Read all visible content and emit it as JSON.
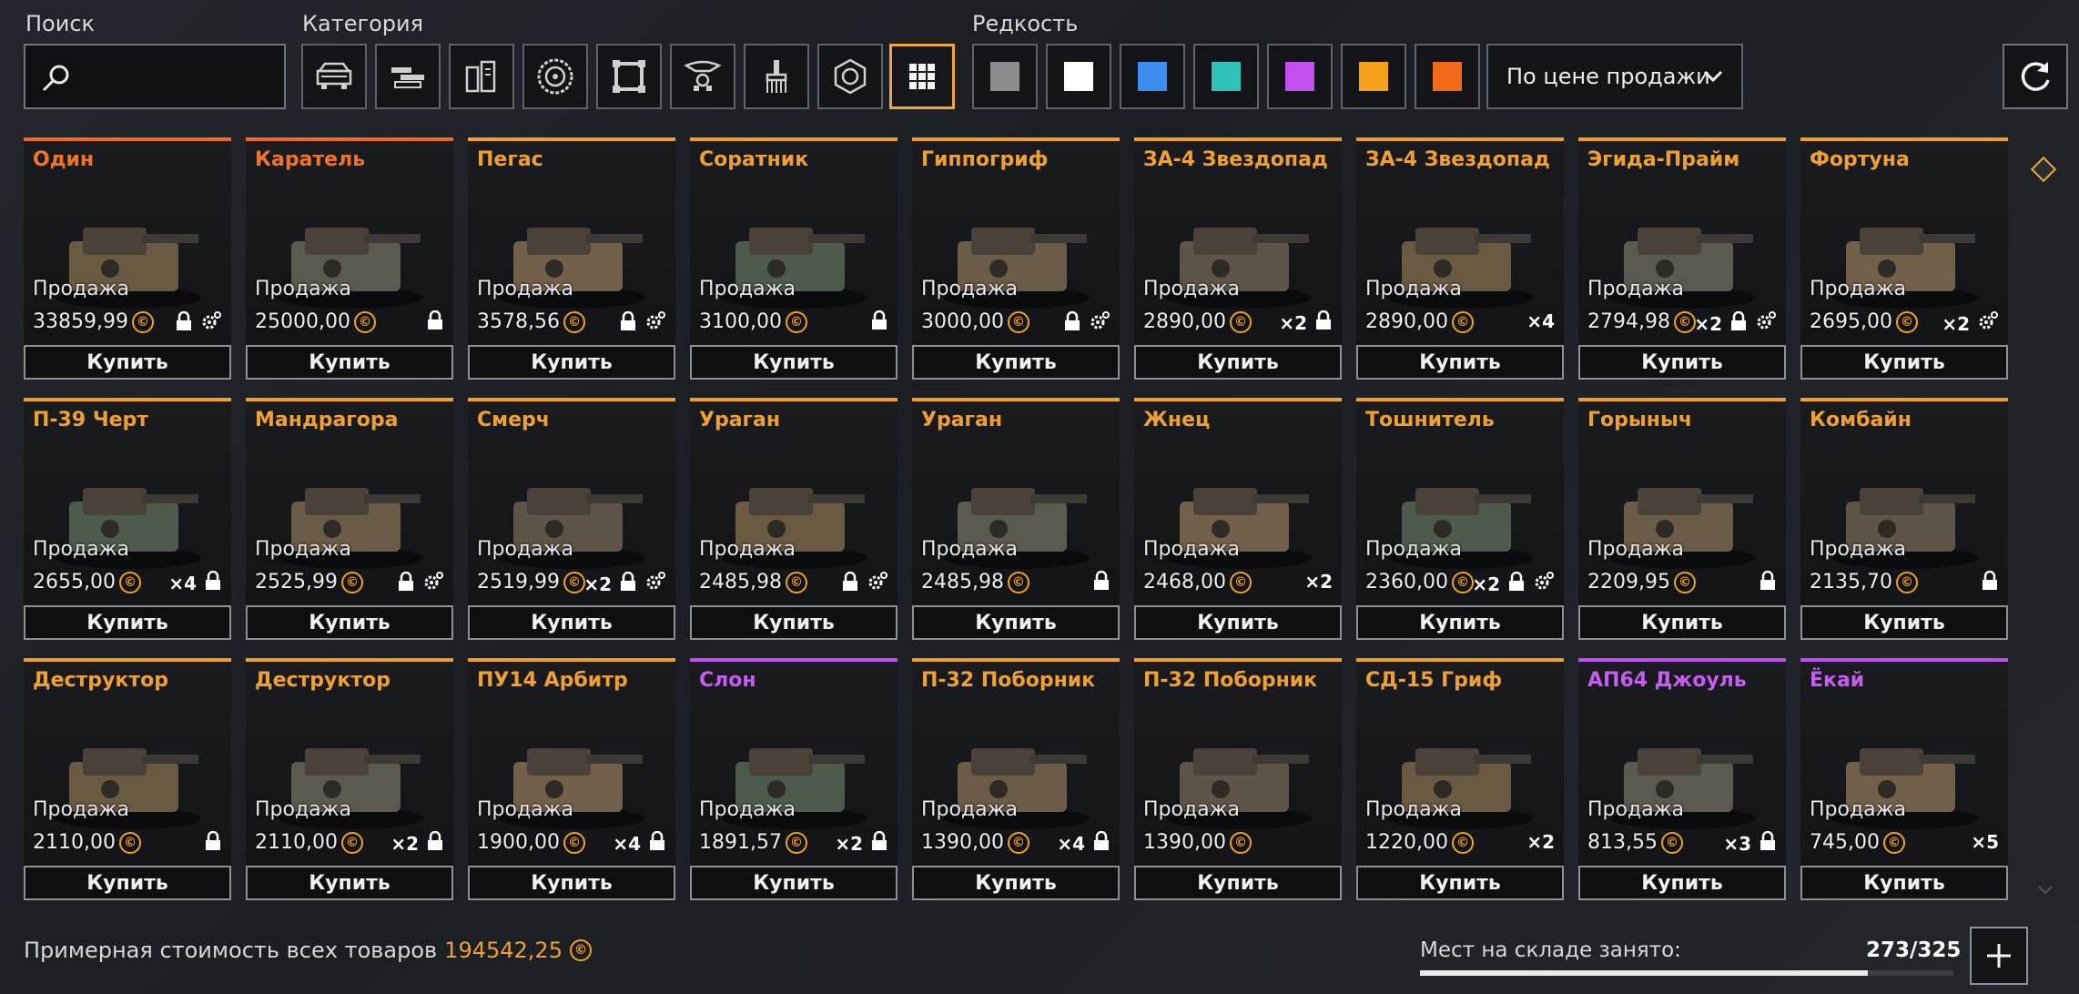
{
  "labels": {
    "search": "Поиск",
    "category": "Категория",
    "rarity": "Редкость"
  },
  "search": {
    "placeholder": "",
    "value": ""
  },
  "categories": [
    {
      "icon": "vehicle-cabin-icon"
    },
    {
      "icon": "weapon-icon"
    },
    {
      "icon": "module-icon"
    },
    {
      "icon": "wheel-icon"
    },
    {
      "icon": "frame-icon"
    },
    {
      "icon": "decor-icon"
    },
    {
      "icon": "paint-icon"
    },
    {
      "icon": "resources-icon"
    },
    {
      "icon": "all-grid-icon",
      "active": true
    }
  ],
  "rarities": [
    {
      "name": "common",
      "color": "#8c8c8c"
    },
    {
      "name": "uncommon",
      "color": "#ffffff"
    },
    {
      "name": "rare",
      "color": "#3b8df0"
    },
    {
      "name": "special",
      "color": "#2fc2b8"
    },
    {
      "name": "epic",
      "color": "#c34ff0"
    },
    {
      "name": "legendary",
      "color": "#f5a21a"
    },
    {
      "name": "relic",
      "color": "#f26a17"
    }
  ],
  "sort": {
    "label": "По цене продажи"
  },
  "common": {
    "sale_label": "Продажа",
    "buy_label": "Купить",
    "coin_symbol": "©"
  },
  "items": [
    {
      "name": "Один",
      "rarity": "red",
      "price": "33859,99",
      "qty": "",
      "lock": true,
      "gear": true
    },
    {
      "name": "Каратель",
      "rarity": "red",
      "price": "25000,00",
      "qty": "",
      "lock": true,
      "gear": false
    },
    {
      "name": "Пегас",
      "rarity": "orange",
      "price": "3578,56",
      "qty": "",
      "lock": true,
      "gear": true
    },
    {
      "name": "Соратник",
      "rarity": "orange",
      "price": "3100,00",
      "qty": "",
      "lock": true,
      "gear": false
    },
    {
      "name": "Гиппогриф",
      "rarity": "orange",
      "price": "3000,00",
      "qty": "",
      "lock": true,
      "gear": true
    },
    {
      "name": "ЗА-4 Звездопад",
      "rarity": "orange",
      "price": "2890,00",
      "qty": "×2",
      "lock": true,
      "gear": false
    },
    {
      "name": "ЗА-4 Звездопад",
      "rarity": "orange",
      "price": "2890,00",
      "qty": "×4",
      "lock": false,
      "gear": false
    },
    {
      "name": "Эгида-Прайм",
      "rarity": "orange",
      "price": "2794,98",
      "qty": "×2",
      "lock": true,
      "gear": true
    },
    {
      "name": "Фортуна",
      "rarity": "orange",
      "price": "2695,00",
      "qty": "×2",
      "lock": false,
      "gear": true
    },
    {
      "name": "П-39 Черт",
      "rarity": "orange",
      "price": "2655,00",
      "qty": "×4",
      "lock": true,
      "gear": false
    },
    {
      "name": "Мандрагора",
      "rarity": "orange",
      "price": "2525,99",
      "qty": "",
      "lock": true,
      "gear": true
    },
    {
      "name": "Смерч",
      "rarity": "orange",
      "price": "2519,99",
      "qty": "×2",
      "lock": true,
      "gear": true
    },
    {
      "name": "Ураган",
      "rarity": "orange",
      "price": "2485,98",
      "qty": "",
      "lock": true,
      "gear": true
    },
    {
      "name": "Ураган",
      "rarity": "orange",
      "price": "2485,98",
      "qty": "",
      "lock": true,
      "gear": false
    },
    {
      "name": "Жнец",
      "rarity": "orange",
      "price": "2468,00",
      "qty": "×2",
      "lock": false,
      "gear": false
    },
    {
      "name": "Тошнитель",
      "rarity": "orange",
      "price": "2360,00",
      "qty": "×2",
      "lock": true,
      "gear": true
    },
    {
      "name": "Горыныч",
      "rarity": "orange",
      "price": "2209,95",
      "qty": "",
      "lock": true,
      "gear": false
    },
    {
      "name": "Комбайн",
      "rarity": "orange",
      "price": "2135,70",
      "qty": "",
      "lock": true,
      "gear": false
    },
    {
      "name": "Деструктор",
      "rarity": "orange",
      "price": "2110,00",
      "qty": "",
      "lock": true,
      "gear": false
    },
    {
      "name": "Деструктор",
      "rarity": "orange",
      "price": "2110,00",
      "qty": "×2",
      "lock": true,
      "gear": false
    },
    {
      "name": "ПУ14 Арбитр",
      "rarity": "orange",
      "price": "1900,00",
      "qty": "×4",
      "lock": true,
      "gear": false
    },
    {
      "name": "Слон",
      "rarity": "purple",
      "price": "1891,57",
      "qty": "×2",
      "lock": true,
      "gear": false
    },
    {
      "name": "П-32 Поборник",
      "rarity": "orange",
      "price": "1390,00",
      "qty": "×4",
      "lock": true,
      "gear": false
    },
    {
      "name": "П-32 Поборник",
      "rarity": "orange",
      "price": "1390,00",
      "qty": "",
      "lock": false,
      "gear": false
    },
    {
      "name": "СД-15 Гриф",
      "rarity": "orange",
      "price": "1220,00",
      "qty": "×2",
      "lock": false,
      "gear": false
    },
    {
      "name": "АП64 Джоуль",
      "rarity": "purple",
      "price": "813,55",
      "qty": "×3",
      "lock": true,
      "gear": false
    },
    {
      "name": "Ёкай",
      "rarity": "purple",
      "price": "745,00",
      "qty": "×5",
      "lock": false,
      "gear": false
    }
  ],
  "footer": {
    "total_label": "Примерная стоимость всех товаров",
    "total_value": "194542,25",
    "storage_label": "Мест на складе занято:",
    "storage_value": "273/325",
    "storage_fraction": 0.84
  }
}
